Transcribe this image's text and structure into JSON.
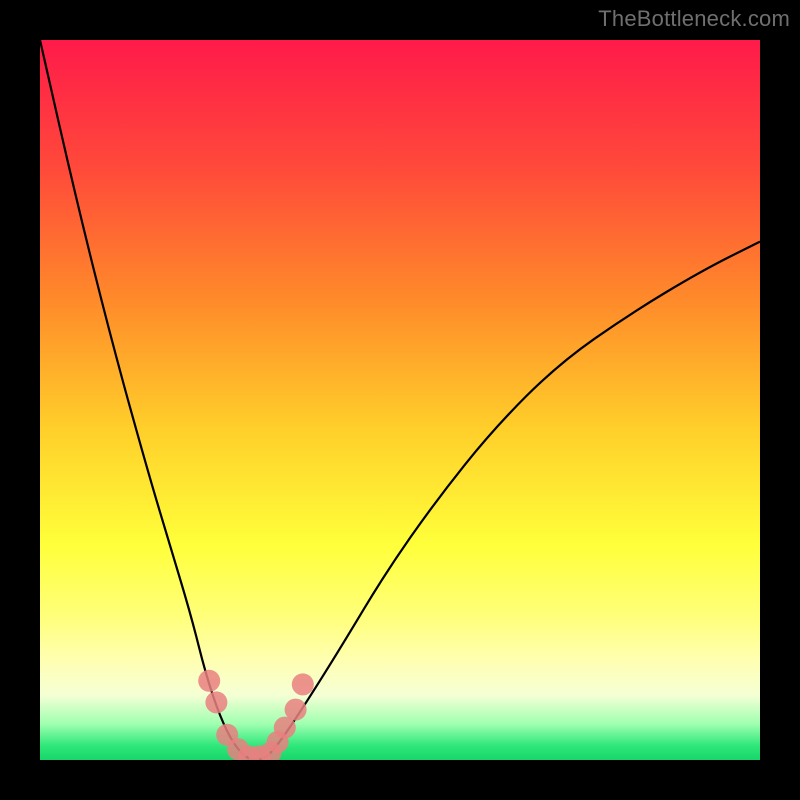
{
  "watermark": "TheBottleneck.com",
  "chart_data": {
    "type": "line",
    "title": "",
    "xlabel": "",
    "ylabel": "",
    "xlim": [
      0,
      100
    ],
    "ylim": [
      0,
      100
    ],
    "grid": false,
    "series": [
      {
        "name": "bottleneck-curve",
        "x": [
          0,
          5,
          10,
          15,
          18,
          21,
          23,
          25,
          27,
          29,
          31,
          33,
          37,
          42,
          48,
          55,
          63,
          72,
          82,
          92,
          100
        ],
        "values": [
          100,
          78,
          58,
          40,
          30,
          20,
          12,
          6,
          2,
          0,
          0,
          2,
          8,
          16,
          26,
          36,
          46,
          55,
          62,
          68,
          72
        ]
      }
    ],
    "markers": {
      "name": "highlight-points",
      "x": [
        23.5,
        24.5,
        26.0,
        27.5,
        29.0,
        30.5,
        32.0,
        33.0,
        34.0,
        35.5,
        36.5
      ],
      "values": [
        11,
        8,
        3.5,
        1.5,
        0.5,
        0.5,
        1.0,
        2.5,
        4.5,
        7.0,
        10.5
      ]
    },
    "background_gradient": {
      "top": "#ff1a4a",
      "mid": "#ffff3a",
      "bottom": "#18d66a"
    },
    "curve_color": "#000000",
    "marker_color": "#e98080"
  }
}
